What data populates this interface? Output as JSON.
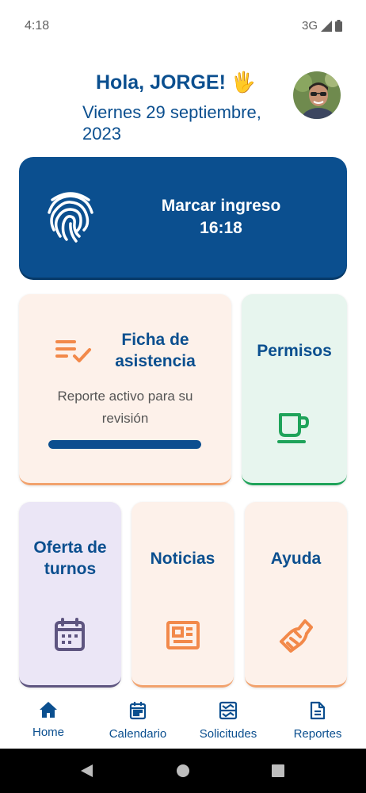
{
  "status_bar": {
    "time": "4:18",
    "network": "3G"
  },
  "greeting": {
    "hello": "Hola, JORGE! 🖐",
    "date": "Viernes 29 septiembre, 2023"
  },
  "punch": {
    "label": "Marcar ingreso",
    "time": "16:18"
  },
  "cards": {
    "ficha": {
      "title": "Ficha de asistencia",
      "description": "Reporte activo para su revisión",
      "progress": 1.0
    },
    "permisos": {
      "title": "Permisos"
    },
    "oferta": {
      "title": "Oferta de turnos"
    },
    "noticias": {
      "title": "Noticias"
    },
    "ayuda": {
      "title": "Ayuda"
    }
  },
  "bottom_nav": [
    {
      "label": "Home",
      "icon": "home-icon"
    },
    {
      "label": "Calendario",
      "icon": "calendar-icon"
    },
    {
      "label": "Solicitudes",
      "icon": "inbox-icon"
    },
    {
      "label": "Reportes",
      "icon": "document-icon"
    }
  ],
  "colors": {
    "brand_blue": "#0b4f8f",
    "orange": "#f2a26d",
    "green": "#1fa35a",
    "purple": "#5e5580"
  }
}
